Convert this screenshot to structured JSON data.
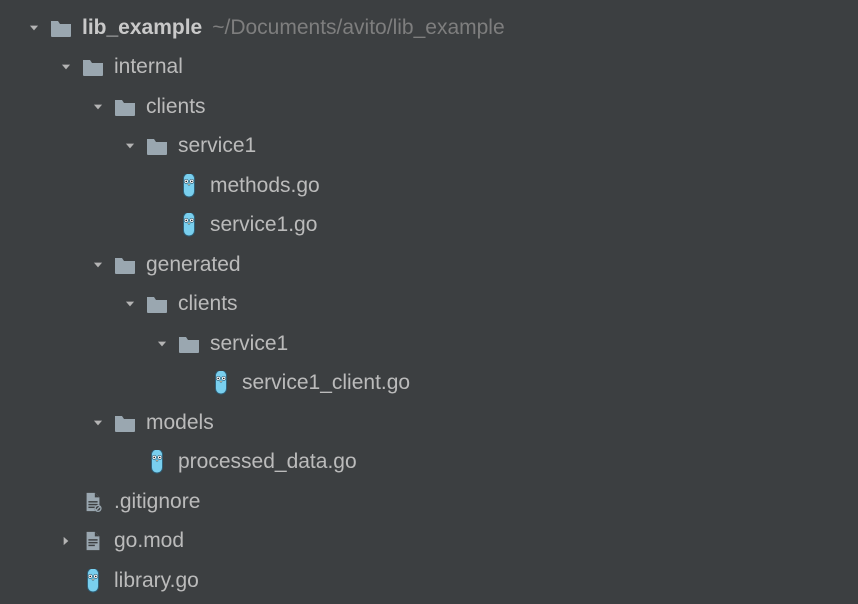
{
  "colors": {
    "bg": "#3c3f41",
    "text": "#bbbbbb",
    "hint": "#7e7e7e",
    "folder": "#9aa7b0",
    "go_body": "#6bc7e8",
    "go_outline": "#2b5f7a",
    "file_fill": "#9aa7b0",
    "file_accent": "#3c3f41"
  },
  "tree": {
    "root": {
      "name": "lib_example",
      "path_hint": "~/Documents/avito/lib_example",
      "expanded": true
    },
    "internal": {
      "name": "internal",
      "expanded": true
    },
    "clients1": {
      "name": "clients",
      "expanded": true
    },
    "service1a": {
      "name": "service1",
      "expanded": true
    },
    "methods_go": {
      "name": "methods.go"
    },
    "service1_go": {
      "name": "service1.go"
    },
    "generated": {
      "name": "generated",
      "expanded": true
    },
    "clients2": {
      "name": "clients",
      "expanded": true
    },
    "service1b": {
      "name": "service1",
      "expanded": true
    },
    "service1_client_go": {
      "name": "service1_client.go"
    },
    "models": {
      "name": "models",
      "expanded": true
    },
    "processed_data_go": {
      "name": "processed_data.go"
    },
    "gitignore": {
      "name": ".gitignore"
    },
    "go_mod": {
      "name": "go.mod",
      "expanded": false
    },
    "library_go": {
      "name": "library.go"
    }
  }
}
